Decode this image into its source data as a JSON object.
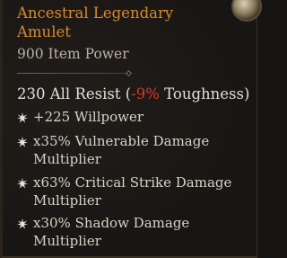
{
  "item": {
    "name": "Ancestral Legendary Amulet",
    "item_power": "900 Item Power",
    "implicit": {
      "value": "230 All Resist (",
      "negative": "-9%",
      "stat": " Toughness)"
    },
    "affixes": [
      {
        "text": "+225 Willpower"
      },
      {
        "text": "x35% Vulnerable Damage Multiplier"
      },
      {
        "text": "x63% Critical Strike Damage Multiplier"
      },
      {
        "text": "x30% Shadow Damage Multiplier"
      }
    ]
  },
  "colors": {
    "legendary": "#d88a2d",
    "negative": "#d83a2c",
    "bullet": "#e8e2d8"
  },
  "icons": {
    "affix_bullet": "star-burst-icon",
    "corner": "amulet-corner-ornament"
  }
}
